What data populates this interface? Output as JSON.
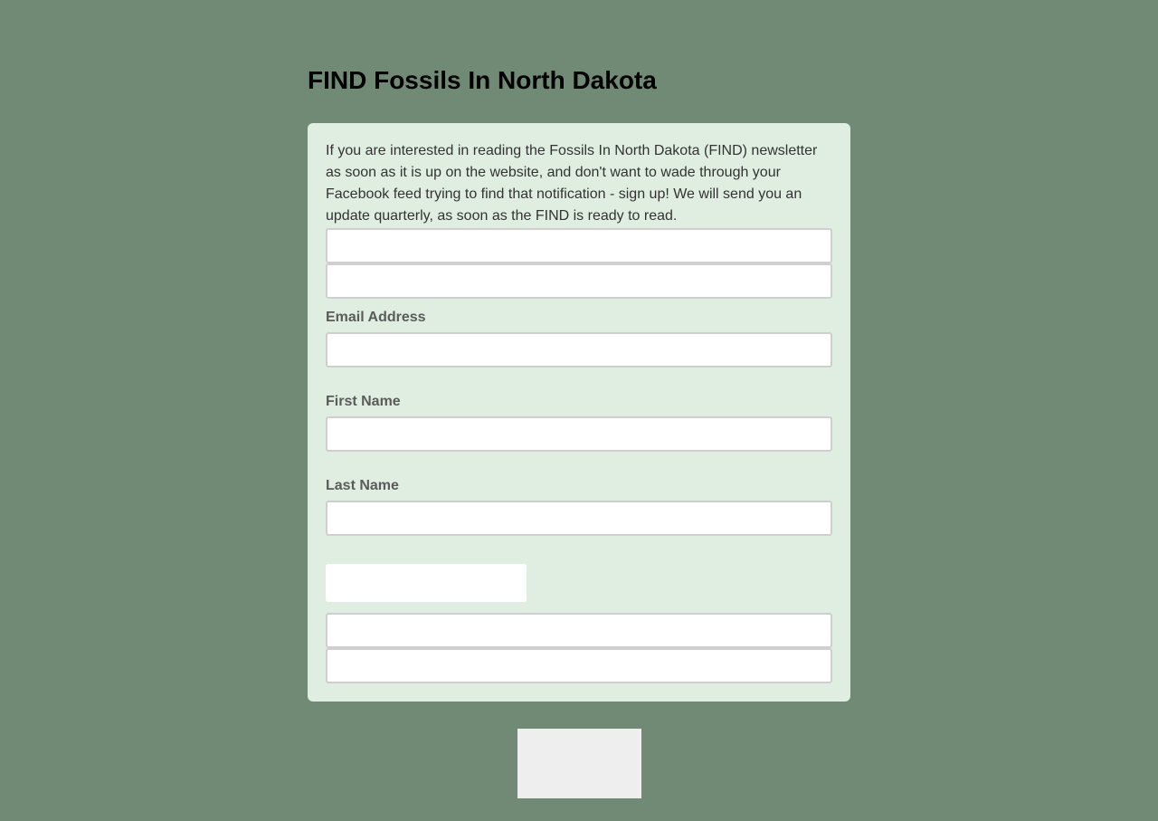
{
  "page": {
    "title": "FIND Fossils In North Dakota"
  },
  "form": {
    "intro": "If you are interested in reading the Fossils In North Dakota (FIND) newsletter as soon as it is up on the website, and don't want to wade through your Facebook feed trying to find that notification - sign up!  We will send you an update quarterly, as soon as the FIND is ready to read.",
    "email_label": "Email Address",
    "first_name_label": "First Name",
    "last_name_label": "Last Name",
    "email_value": "",
    "first_name_value": "",
    "last_name_value": "",
    "submit_label": ""
  },
  "colors": {
    "background": "#718a75",
    "card": "#dfeee1",
    "label": "#5b5b5b",
    "text": "#333333",
    "input_border": "#cfcfcf",
    "submit": "#eeeeee"
  }
}
